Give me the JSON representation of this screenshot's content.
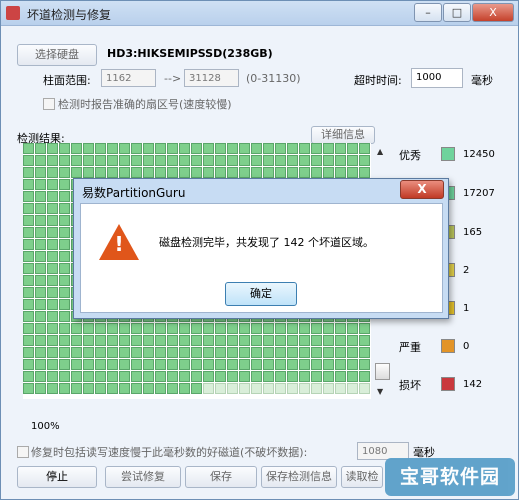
{
  "window": {
    "title": "坏道检测与修复",
    "controls": {
      "minimize": "–",
      "maximize": "□",
      "close": "X"
    }
  },
  "disk": {
    "select_button": "选择硬盘",
    "name": "HD3:HIKSEMIPSSD(238GB)"
  },
  "range": {
    "label": "柱面范围:",
    "start": "1162",
    "separator": "-->",
    "end": "31128",
    "hint": "(0-31130)"
  },
  "timeout": {
    "label": "超时时间:",
    "value": "1000",
    "unit": "毫秒"
  },
  "report_sector_checkbox": {
    "label": "检测时报告准确的扇区号(速度较慢)",
    "checked": false
  },
  "results": {
    "label": "检测结果:",
    "details_button": "详细信息"
  },
  "legend": [
    {
      "label": "优秀",
      "color": "#6fd39c",
      "value": "12450"
    },
    {
      "label": "",
      "color": "#6fd39c",
      "value": "17207"
    },
    {
      "label": "",
      "color": "#b8c35a",
      "value": "165"
    },
    {
      "label": "",
      "color": "#e2d04a",
      "value": "2"
    },
    {
      "label": "",
      "color": "#e6c22b",
      "value": "1"
    },
    {
      "label": "严重",
      "color": "#e39427",
      "value": "0"
    },
    {
      "label": "损坏",
      "color": "#c9383d",
      "value": "142"
    }
  ],
  "progress_text": "100%",
  "repair_checkbox": {
    "label": "修复时包括读写速度慢于此毫秒数的好磁道(不破坏数据):",
    "checked": false,
    "value": "1080",
    "unit": "毫秒"
  },
  "actions": {
    "stop": "停止",
    "try_repair": "尝试修复",
    "save": "保存",
    "save_info": "保存检测信息",
    "read_info": "读取检"
  },
  "dialog": {
    "title": "易数PartitionGuru",
    "close": "X",
    "message": "磁盘检测完毕，共发现了 142 个坏道区域。",
    "ok": "确定"
  },
  "watermark": "宝哥软件园"
}
